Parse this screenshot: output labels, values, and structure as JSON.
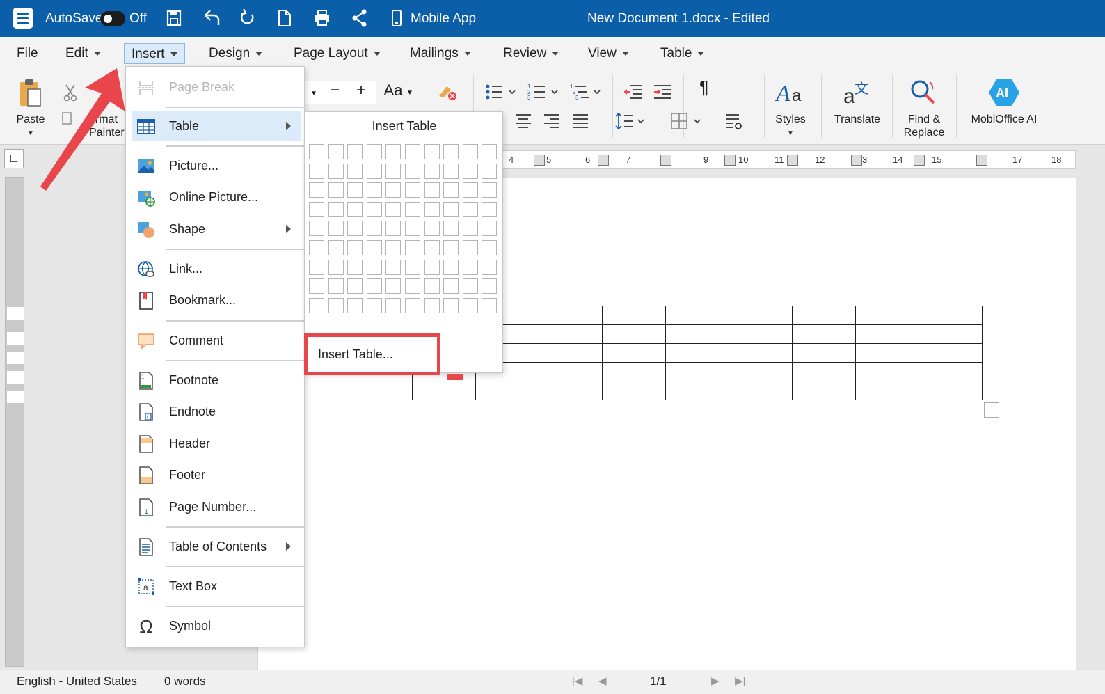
{
  "titlebar": {
    "autosave_label": "AutoSave",
    "autosave_state": "Off",
    "mobile_app_label": "Mobile App",
    "document_title": "New Document 1.docx - Edited"
  },
  "menubar": {
    "items": [
      {
        "label": "File"
      },
      {
        "label": "Edit"
      },
      {
        "label": "Insert"
      },
      {
        "label": "Design"
      },
      {
        "label": "Page Layout"
      },
      {
        "label": "Mailings"
      },
      {
        "label": "Review"
      },
      {
        "label": "View"
      },
      {
        "label": "Table"
      }
    ]
  },
  "ribbon": {
    "paste": "Paste",
    "format_painter_line1": "ormat",
    "format_painter_line2": "Painter",
    "font_case": "Aa",
    "styles": "Styles",
    "translate": "Translate",
    "find_line1": "Find &",
    "find_line2": "Replace",
    "ai_label": "MobiOffice AI",
    "ai_badge": "AI"
  },
  "insert_menu": {
    "items": [
      {
        "label": "Page Break",
        "icon": "page-break-icon"
      },
      {
        "label": "Table",
        "icon": "table-icon"
      },
      {
        "label": "Picture...",
        "icon": "picture-icon"
      },
      {
        "label": "Online Picture...",
        "icon": "online-picture-icon"
      },
      {
        "label": "Shape",
        "icon": "shape-icon"
      },
      {
        "label": "Link...",
        "icon": "link-icon"
      },
      {
        "label": "Bookmark...",
        "icon": "bookmark-icon"
      },
      {
        "label": "Comment",
        "icon": "comment-icon"
      },
      {
        "label": "Footnote",
        "icon": "footnote-icon"
      },
      {
        "label": "Endnote",
        "icon": "endnote-icon"
      },
      {
        "label": "Header",
        "icon": "header-icon"
      },
      {
        "label": "Footer",
        "icon": "footer-icon"
      },
      {
        "label": "Page Number...",
        "icon": "page-number-icon"
      },
      {
        "label": "Table of Contents",
        "icon": "table-of-contents-icon"
      },
      {
        "label": "Text Box",
        "icon": "text-box-icon"
      },
      {
        "label": "Symbol",
        "icon": "symbol-icon"
      }
    ]
  },
  "table_submenu": {
    "title": "Insert Table",
    "grid_columns": 10,
    "grid_rows": 9,
    "insert_table_button": "Insert Table..."
  },
  "ruler": {
    "h_numbers": [
      "4",
      "5",
      "6",
      "7",
      "9",
      "10",
      "11",
      "12",
      "3",
      "14",
      "15",
      "17",
      "18"
    ]
  },
  "statusbar": {
    "language": "English - United States",
    "words": "0 words",
    "page": "1/1"
  },
  "colors": {
    "titlebar": "#0b5ea8",
    "highlight": "#e8464b",
    "menu_hover": "#dcebf9"
  }
}
